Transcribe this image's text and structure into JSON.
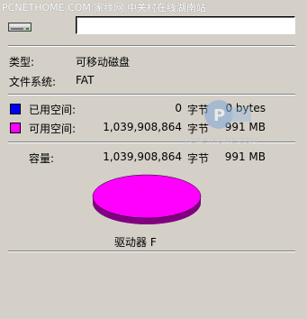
{
  "watermark": "PCNETHOME.COM 家缘网 中关村在线湖南站",
  "watermark_logo_text": "PCNETHOME.COM",
  "icons": {
    "drive": "removable-drive-icon"
  },
  "name_input": {
    "value": ""
  },
  "type": {
    "label": "类型:",
    "value": "可移动磁盘"
  },
  "filesystem": {
    "label": "文件系统:",
    "value": "FAT"
  },
  "used": {
    "label": "已用空间:",
    "bytes": "0",
    "unit": "字节",
    "size": "0 bytes",
    "color": "#0000ff"
  },
  "free": {
    "label": "可用空间:",
    "bytes": "1,039,908,864",
    "unit": "字节",
    "size": "991 MB",
    "color": "#ff00ff"
  },
  "capacity": {
    "label": "容量:",
    "bytes": "1,039,908,864",
    "unit": "字节",
    "size": "991 MB"
  },
  "drive_label": "驱动器 F",
  "colors": {
    "pie_top": "#ff00ff",
    "pie_side": "#800080",
    "dialog_bg": "#d4d0c8"
  },
  "chart_data": {
    "type": "pie",
    "categories": [
      "已用空间",
      "可用空间"
    ],
    "values": [
      0,
      1039908864
    ]
  }
}
